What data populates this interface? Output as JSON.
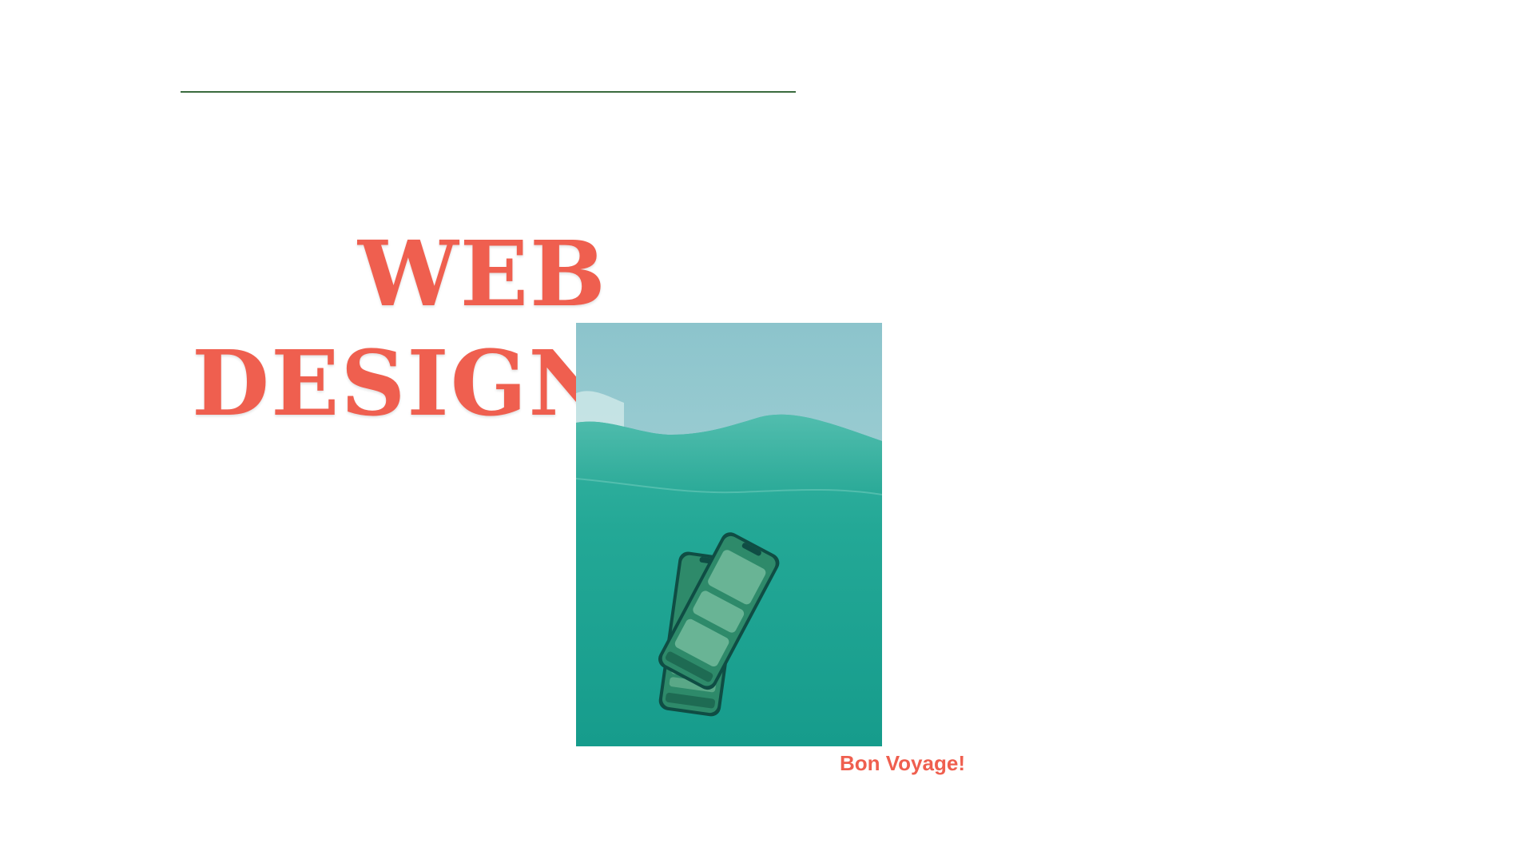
{
  "title": {
    "line1": "WEB",
    "line2": "DESIGN"
  },
  "caption": "Bon Voyage!",
  "image": {
    "icon": "underwater-phones-image"
  },
  "colors": {
    "accent": "#ef5f4f",
    "rule": "#3a6b3e",
    "water": "#1fa896",
    "sky": "#8fc7cf"
  }
}
